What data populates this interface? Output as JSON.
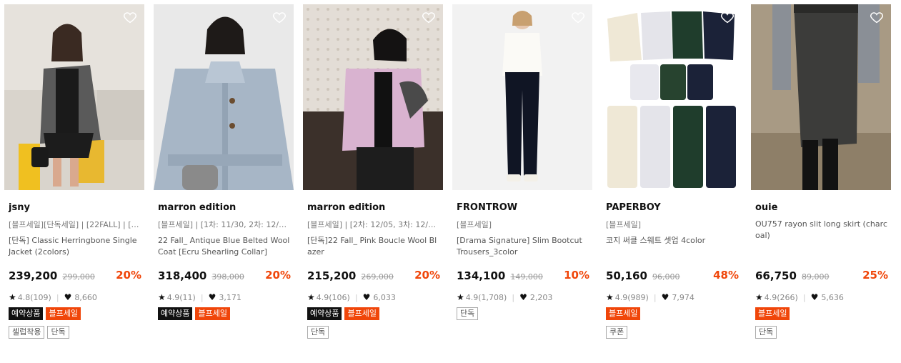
{
  "products": [
    {
      "brand": "jsny",
      "subline": "[블프세일][단독세일] | [22FALL] | [1...",
      "title": "[단독] Classic Herringbone Single Jacket (2colors)",
      "price": "239,200",
      "original_price": "299,000",
      "discount": "20%",
      "rating": "4.8(109)",
      "likes": "8,660",
      "badges_row1": [
        {
          "label": "예약상품",
          "style": "dark"
        },
        {
          "label": "블프세일",
          "style": "orange"
        }
      ],
      "badges_row2": [
        {
          "label": "셀럽착용",
          "style": "outline"
        },
        {
          "label": "단독",
          "style": "outline"
        }
      ]
    },
    {
      "brand": "marron edition",
      "subline": "[블프세일] | [1차: 11/30, 2차: 12/05 ...",
      "title": "22 Fall_ Antique Blue Belted Wool Coat [Ecru Shearling Collar]",
      "price": "318,400",
      "original_price": "398,000",
      "discount": "20%",
      "rating": "4.9(11)",
      "likes": "3,171",
      "badges_row1": [
        {
          "label": "예약상품",
          "style": "dark"
        },
        {
          "label": "블프세일",
          "style": "orange"
        }
      ],
      "badges_row2": []
    },
    {
      "brand": "marron edition",
      "subline": "[블프세일] | [2차: 12/05, 3차: 12/09 ...",
      "title": "[단독]22 Fall_ Pink Boucle Wool Blazer",
      "price": "215,200",
      "original_price": "269,000",
      "discount": "20%",
      "rating": "4.9(106)",
      "likes": "6,033",
      "badges_row1": [
        {
          "label": "예약상품",
          "style": "dark"
        },
        {
          "label": "블프세일",
          "style": "orange"
        }
      ],
      "badges_row2": [
        {
          "label": "단독",
          "style": "outline"
        }
      ]
    },
    {
      "brand": "FRONTROW",
      "subline": "[블프세일]",
      "title": "[Drama Signature] Slim Bootcut Trousers_3color",
      "price": "134,100",
      "original_price": "149,000",
      "discount": "10%",
      "rating": "4.9(1,708)",
      "likes": "2,203",
      "badges_row1": [
        {
          "label": "단독",
          "style": "outline"
        }
      ],
      "badges_row2": []
    },
    {
      "brand": "PAPERBOY",
      "subline": "[블프세일]",
      "title": "코지 써클 스웨트 셋업 4color",
      "price": "50,160",
      "original_price": "96,000",
      "discount": "48%",
      "rating": "4.9(989)",
      "likes": "7,974",
      "badges_row1": [
        {
          "label": "블프세일",
          "style": "orange"
        }
      ],
      "badges_row2": [
        {
          "label": "쿠폰",
          "style": "outline"
        }
      ]
    },
    {
      "brand": "ouie",
      "subline": "OU757 rayon slit long skirt (charcoal)",
      "title": "",
      "price": "66,750",
      "original_price": "89,000",
      "discount": "25%",
      "rating": "4.9(266)",
      "likes": "5,636",
      "badges_row1": [
        {
          "label": "블프세일",
          "style": "orange"
        }
      ],
      "badges_row2": [
        {
          "label": "단독",
          "style": "outline"
        }
      ]
    }
  ],
  "icons": {
    "wishlist": "heart-outline-icon",
    "rating": "star-icon",
    "likes": "heart-filled-icon"
  },
  "colors": {
    "discount": "#f0460a",
    "badge_dark": "#111111",
    "badge_orange": "#f0460a"
  }
}
